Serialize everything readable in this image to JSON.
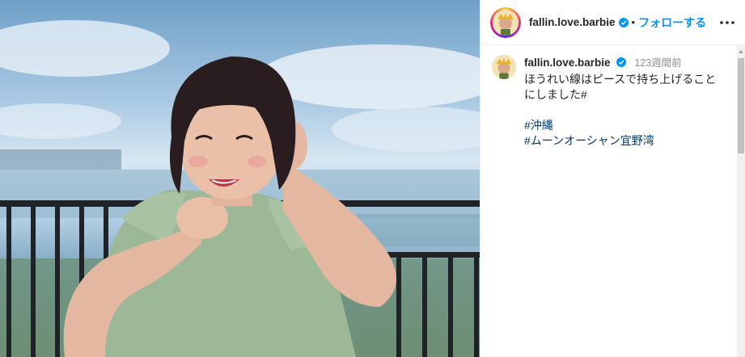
{
  "post": {
    "username": "fallin.love.barbie",
    "separator": "•",
    "follow_label": "フォローする",
    "more_icon": "more-horizontal-icon",
    "verified_icon": "verified-badge-icon"
  },
  "caption": {
    "username": "fallin.love.barbie",
    "time": "123週間前",
    "text": "ほうれい線はピースで持ち上げることにしました#",
    "hashtags": [
      "#沖縄",
      "#ムーンオーシャン宜野湾"
    ]
  },
  "colors": {
    "accent": "#0095f6",
    "hashtag": "#00376b",
    "muted": "#8e8e8e",
    "verified": "#0095f6"
  }
}
